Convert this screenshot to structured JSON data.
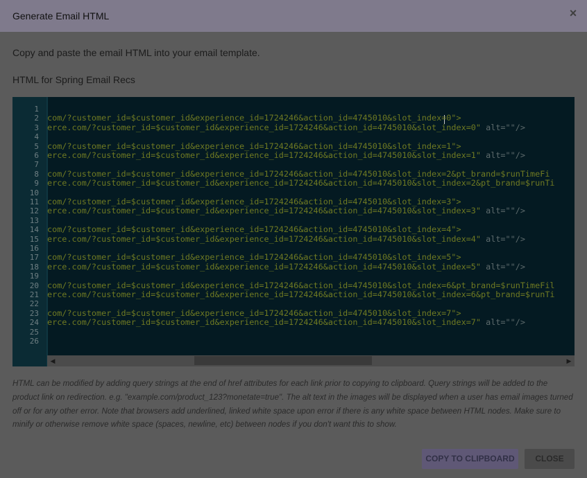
{
  "dialog": {
    "title": "Generate Email HTML",
    "close_icon": "×",
    "intro": "Copy and paste the email HTML into your email template.",
    "subheading": "HTML for Spring Email Recs"
  },
  "editor": {
    "line_numbers": [
      "1",
      "2",
      "3",
      "4",
      "5",
      "6",
      "7",
      "8",
      "9",
      "10",
      "11",
      "12",
      "13",
      "14",
      "15",
      "16",
      "17",
      "18",
      "19",
      "20",
      "21",
      "22",
      "23",
      "24",
      "25",
      "26"
    ],
    "lines": [
      {
        "url": "",
        "str": ""
      },
      {
        "url": "com/?customer_id=$customer_id&experience_id=1724246&action_id=4745010&slot_index=0\">",
        "str": ""
      },
      {
        "url": "erce.com/?customer_id=$customer_id&experience_id=1724246&action_id=4745010&slot_index=0\" ",
        "str": "alt=\"\"/>"
      },
      {
        "url": "",
        "str": ""
      },
      {
        "url": "com/?customer_id=$customer_id&experience_id=1724246&action_id=4745010&slot_index=1\">",
        "str": ""
      },
      {
        "url": "erce.com/?customer_id=$customer_id&experience_id=1724246&action_id=4745010&slot_index=1\" ",
        "str": "alt=\"\"/>"
      },
      {
        "url": "",
        "str": ""
      },
      {
        "url": "com/?customer_id=$customer_id&experience_id=1724246&action_id=4745010&slot_index=2&pt_brand=$runTimeFi",
        "str": ""
      },
      {
        "url": "erce.com/?customer_id=$customer_id&experience_id=1724246&action_id=4745010&slot_index=2&pt_brand=$runTi",
        "str": ""
      },
      {
        "url": "",
        "str": ""
      },
      {
        "url": "com/?customer_id=$customer_id&experience_id=1724246&action_id=4745010&slot_index=3\">",
        "str": ""
      },
      {
        "url": "erce.com/?customer_id=$customer_id&experience_id=1724246&action_id=4745010&slot_index=3\" ",
        "str": "alt=\"\"/>"
      },
      {
        "url": "",
        "str": ""
      },
      {
        "url": "com/?customer_id=$customer_id&experience_id=1724246&action_id=4745010&slot_index=4\">",
        "str": ""
      },
      {
        "url": "erce.com/?customer_id=$customer_id&experience_id=1724246&action_id=4745010&slot_index=4\" ",
        "str": "alt=\"\"/>"
      },
      {
        "url": "",
        "str": ""
      },
      {
        "url": "com/?customer_id=$customer_id&experience_id=1724246&action_id=4745010&slot_index=5\">",
        "str": ""
      },
      {
        "url": "erce.com/?customer_id=$customer_id&experience_id=1724246&action_id=4745010&slot_index=5\" ",
        "str": "alt=\"\"/>"
      },
      {
        "url": "",
        "str": ""
      },
      {
        "url": "com/?customer_id=$customer_id&experience_id=1724246&action_id=4745010&slot_index=6&pt_brand=$runTimeFil",
        "str": ""
      },
      {
        "url": "erce.com/?customer_id=$customer_id&experience_id=1724246&action_id=4745010&slot_index=6&pt_brand=$runTi",
        "str": ""
      },
      {
        "url": "",
        "str": ""
      },
      {
        "url": "com/?customer_id=$customer_id&experience_id=1724246&action_id=4745010&slot_index=7\">",
        "str": ""
      },
      {
        "url": "erce.com/?customer_id=$customer_id&experience_id=1724246&action_id=4745010&slot_index=7\" ",
        "str": "alt=\"\"/>"
      },
      {
        "url": "",
        "str": ""
      },
      {
        "url": "",
        "str": ""
      }
    ],
    "scroll_left_icon": "◀",
    "scroll_right_icon": "▶"
  },
  "help_text": "HTML can be modified by adding query strings at the end of href attributes for each link prior to copying to clipboard. Query strings will be added to the product link on redirection. e.g. \"example.com/product_123?monetate=true\". The alt text in the images will be displayed when a user has email images turned off or for any other error. Note that browsers add underlined, linked white space upon error if there is any white space between HTML nodes. Make sure to minify or otherwise remove white space (spaces, newline, etc) between nodes if you don't want this to show.",
  "buttons": {
    "copy": "COPY TO CLIPBOARD",
    "close": "CLOSE"
  }
}
